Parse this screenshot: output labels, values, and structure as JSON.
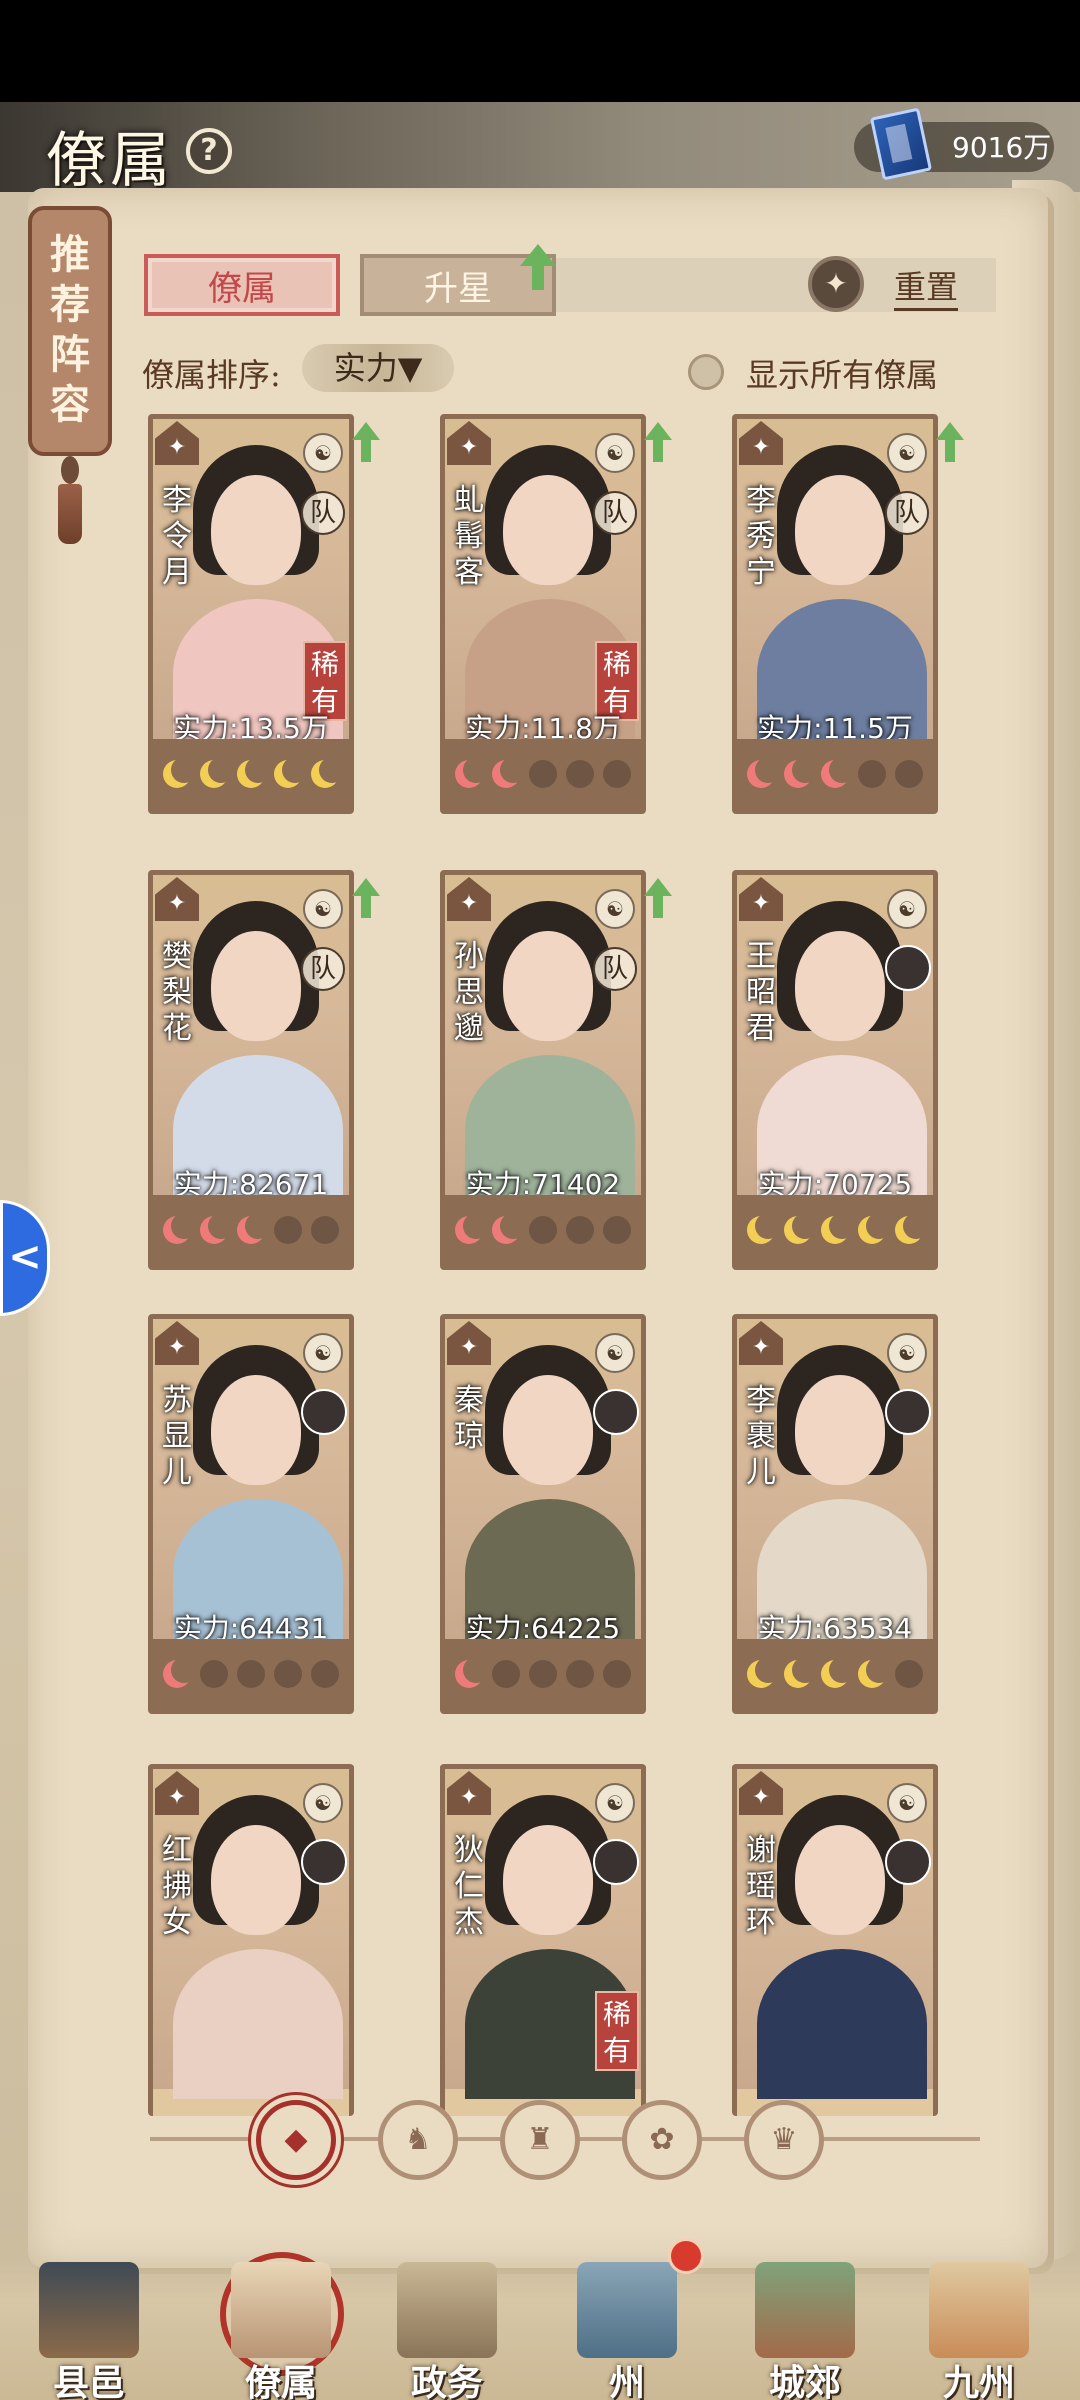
{
  "header": {
    "title": "僚属",
    "help_icon": "?",
    "currency_value": "9016万"
  },
  "recommend_tag": [
    "推",
    "荐",
    "阵",
    "容"
  ],
  "tabs": [
    {
      "label": "僚属",
      "active": true
    },
    {
      "label": "升星",
      "active": false
    }
  ],
  "reset_label": "重置",
  "sort": {
    "label": "僚属排序:",
    "value": "实力▼"
  },
  "show_all_label": "显示所有僚属",
  "cards": [
    {
      "name": [
        "李",
        "令",
        "月"
      ],
      "rarity": "稀有",
      "power": "实力:13.5万",
      "team": "队",
      "moons": 6,
      "moon_color": "gold",
      "moon_filled": 6,
      "up": true
    },
    {
      "name": [
        "虬",
        "髯",
        "客"
      ],
      "rarity": "稀有",
      "power": "实力:11.8万",
      "team": "队",
      "moons": 5,
      "moon_color": "pink",
      "moon_filled": 2,
      "up": true
    },
    {
      "name": [
        "李",
        "秀",
        "宁"
      ],
      "rarity": "",
      "power": "实力:11.5万",
      "team": "队",
      "moons": 6,
      "moon_color": "pink",
      "moon_filled": 3,
      "up": true
    },
    {
      "name": [
        "樊",
        "梨",
        "花"
      ],
      "rarity": "",
      "power": "实力:82671",
      "team": "队",
      "moons": 6,
      "moon_color": "pink",
      "moon_filled": 3,
      "up": true
    },
    {
      "name": [
        "孙",
        "思",
        "邈"
      ],
      "rarity": "",
      "power": "实力:71402",
      "team": "队",
      "moons": 6,
      "moon_color": "pink",
      "moon_filled": 2,
      "up": true
    },
    {
      "name": [
        "王",
        "昭",
        "君"
      ],
      "rarity": "",
      "power": "实力:70725",
      "team": "",
      "moons": 6,
      "moon_color": "gold",
      "moon_filled": 6,
      "up": false
    },
    {
      "name": [
        "苏",
        "显",
        "儿"
      ],
      "rarity": "",
      "power": "实力:64431",
      "team": "",
      "moons": 5,
      "moon_color": "pink",
      "moon_filled": 1,
      "up": false
    },
    {
      "name": [
        "秦",
        "琼"
      ],
      "rarity": "",
      "power": "实力:64225",
      "team": "",
      "moons": 6,
      "moon_color": "pink",
      "moon_filled": 1,
      "up": false
    },
    {
      "name": [
        "李",
        "裹",
        "儿"
      ],
      "rarity": "",
      "power": "实力:63534",
      "team": "",
      "moons": 6,
      "moon_color": "gold",
      "moon_filled": 4,
      "up": false
    },
    {
      "name": [
        "红",
        "拂",
        "女"
      ],
      "rarity": "",
      "power": "",
      "team": "",
      "moons": 0,
      "moon_color": "gold",
      "moon_filled": 0,
      "up": false
    },
    {
      "name": [
        "狄",
        "仁",
        "杰"
      ],
      "rarity": "稀有",
      "power": "",
      "team": "",
      "moons": 0,
      "moon_color": "gold",
      "moon_filled": 0,
      "up": false
    },
    {
      "name": [
        "谢",
        "瑶",
        "环"
      ],
      "rarity": "",
      "power": "",
      "team": "",
      "moons": 0,
      "moon_color": "gold",
      "moon_filled": 0,
      "up": false
    }
  ],
  "filters": [
    "all-faction-icon",
    "tiger-faction-icon",
    "ox-faction-icon",
    "fan-faction-icon",
    "lion-faction-icon"
  ],
  "bottom_nav": [
    {
      "label": "县邑"
    },
    {
      "label": "僚属",
      "active": true
    },
    {
      "label": "政务"
    },
    {
      "label": "州"
    },
    {
      "label": "城郊"
    },
    {
      "label": "九州"
    }
  ],
  "side_float_icon": "<"
}
